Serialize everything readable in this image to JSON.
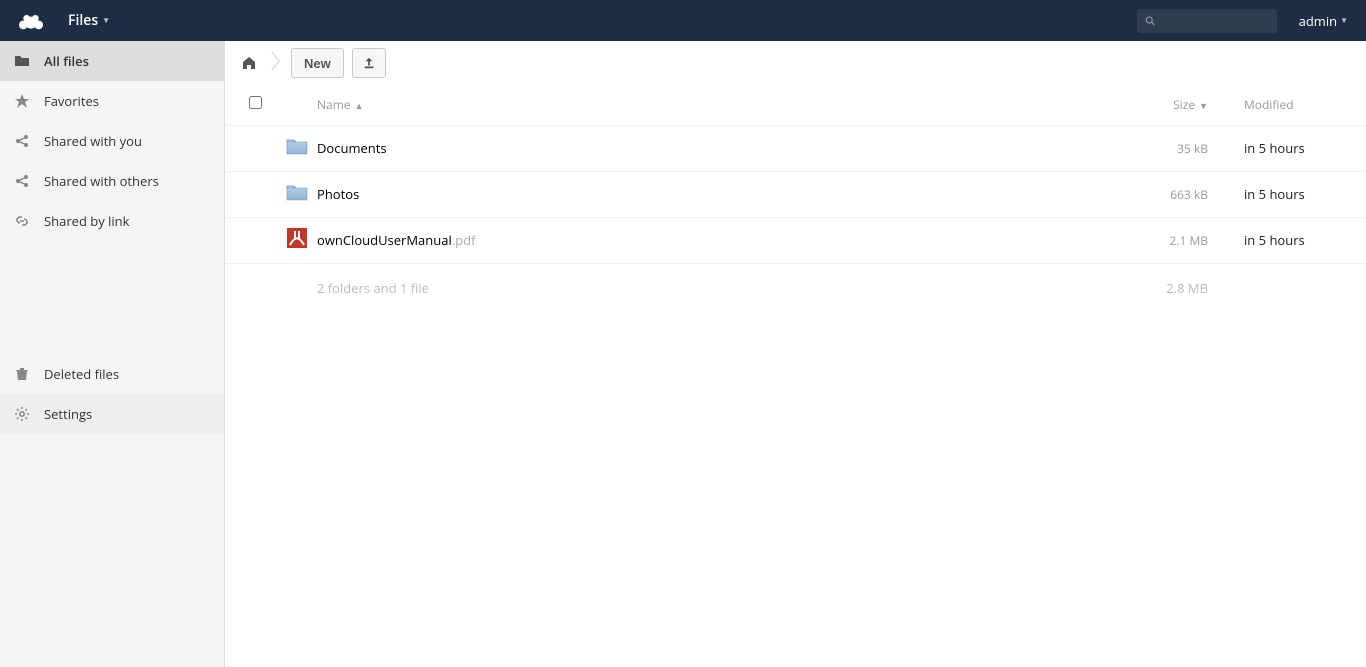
{
  "header": {
    "appName": "Files",
    "searchPlaceholder": "",
    "userLabel": "admin"
  },
  "sidebar": {
    "items": [
      {
        "key": "all-files",
        "label": "All files",
        "active": true
      },
      {
        "key": "favorites",
        "label": "Favorites",
        "active": false
      },
      {
        "key": "shared-with-you",
        "label": "Shared with you",
        "active": false
      },
      {
        "key": "shared-with-others",
        "label": "Shared with others",
        "active": false
      },
      {
        "key": "shared-by-link",
        "label": "Shared by link",
        "active": false
      }
    ],
    "bottom": [
      {
        "key": "deleted-files",
        "label": "Deleted files"
      },
      {
        "key": "settings",
        "label": "Settings"
      }
    ]
  },
  "controls": {
    "newLabel": "New"
  },
  "columns": {
    "name": "Name",
    "size": "Size",
    "modified": "Modified"
  },
  "files": [
    {
      "type": "folder",
      "name": "Documents",
      "ext": "",
      "size": "35 kB",
      "modified": "in 5 hours"
    },
    {
      "type": "folder",
      "name": "Photos",
      "ext": "",
      "size": "663 kB",
      "modified": "in 5 hours"
    },
    {
      "type": "pdf",
      "name": "ownCloudUserManual",
      "ext": ".pdf",
      "size": "2.1 MB",
      "modified": "in 5 hours"
    }
  ],
  "summary": {
    "text": "2 folders and 1 file",
    "totalSize": "2.8 MB"
  }
}
